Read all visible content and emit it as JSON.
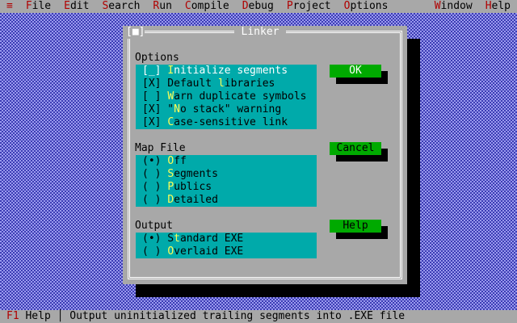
{
  "menubar": {
    "system": "≡",
    "items": [
      {
        "hot": "F",
        "rest": "ile"
      },
      {
        "hot": "E",
        "rest": "dit"
      },
      {
        "hot": "S",
        "rest": "earch"
      },
      {
        "hot": "R",
        "rest": "un"
      },
      {
        "hot": "C",
        "rest": "ompile"
      },
      {
        "hot": "D",
        "rest": "ebug"
      },
      {
        "hot": "P",
        "rest": "roject"
      },
      {
        "hot": "O",
        "rest": "ptions"
      }
    ],
    "right_items": [
      {
        "hot": "W",
        "rest": "indow"
      },
      {
        "hot": "H",
        "rest": "elp"
      }
    ]
  },
  "dialog": {
    "title": "Linker",
    "close": "[■]",
    "options": {
      "label": "Options",
      "items": [
        {
          "box": "[_]",
          "pre": " ",
          "hot": "I",
          "rest": "nitialize segments",
          "focused": true
        },
        {
          "box": "[X]",
          "pre": " Default ",
          "hot": "l",
          "rest": "ibraries",
          "focused": false
        },
        {
          "box": "[ ]",
          "pre": " ",
          "hot": "W",
          "rest": "arn duplicate symbols",
          "focused": false
        },
        {
          "box": "[X]",
          "pre": " \"",
          "hot": "N",
          "rest": "o stack\" warning",
          "focused": false
        },
        {
          "box": "[X]",
          "pre": " ",
          "hot": "C",
          "rest": "ase-sensitive link",
          "focused": false
        }
      ]
    },
    "map_file": {
      "label": "Map File",
      "items": [
        {
          "box": "(•)",
          "pre": " ",
          "hot": "O",
          "rest": "ff"
        },
        {
          "box": "( )",
          "pre": " ",
          "hot": "S",
          "rest": "egments"
        },
        {
          "box": "( )",
          "pre": " ",
          "hot": "P",
          "rest": "ublics"
        },
        {
          "box": "( )",
          "pre": " ",
          "hot": "D",
          "rest": "etailed"
        }
      ]
    },
    "output": {
      "label": "Output",
      "items": [
        {
          "box": "(•)",
          "pre": " S",
          "hot": "t",
          "rest": "andard EXE"
        },
        {
          "box": "( )",
          "pre": " ",
          "hot": "O",
          "rest": "verlaid EXE"
        }
      ]
    },
    "buttons": {
      "ok": {
        "label": "OK"
      },
      "cancel": {
        "label": "Cancel"
      },
      "help": {
        "label": "Help"
      }
    }
  },
  "statusbar": {
    "key": "F1",
    "key_label": " Help",
    "separator": " │ ",
    "message": "Output uninitialized trailing segments into .EXE file"
  },
  "colors": {
    "desktop": "#3c3cb4",
    "dialog": "#a8a8a8",
    "group": "#00aaaa",
    "button": "#00aa00",
    "hotkey_menu": "#b00000",
    "hotkey_option": "#ffff55"
  }
}
